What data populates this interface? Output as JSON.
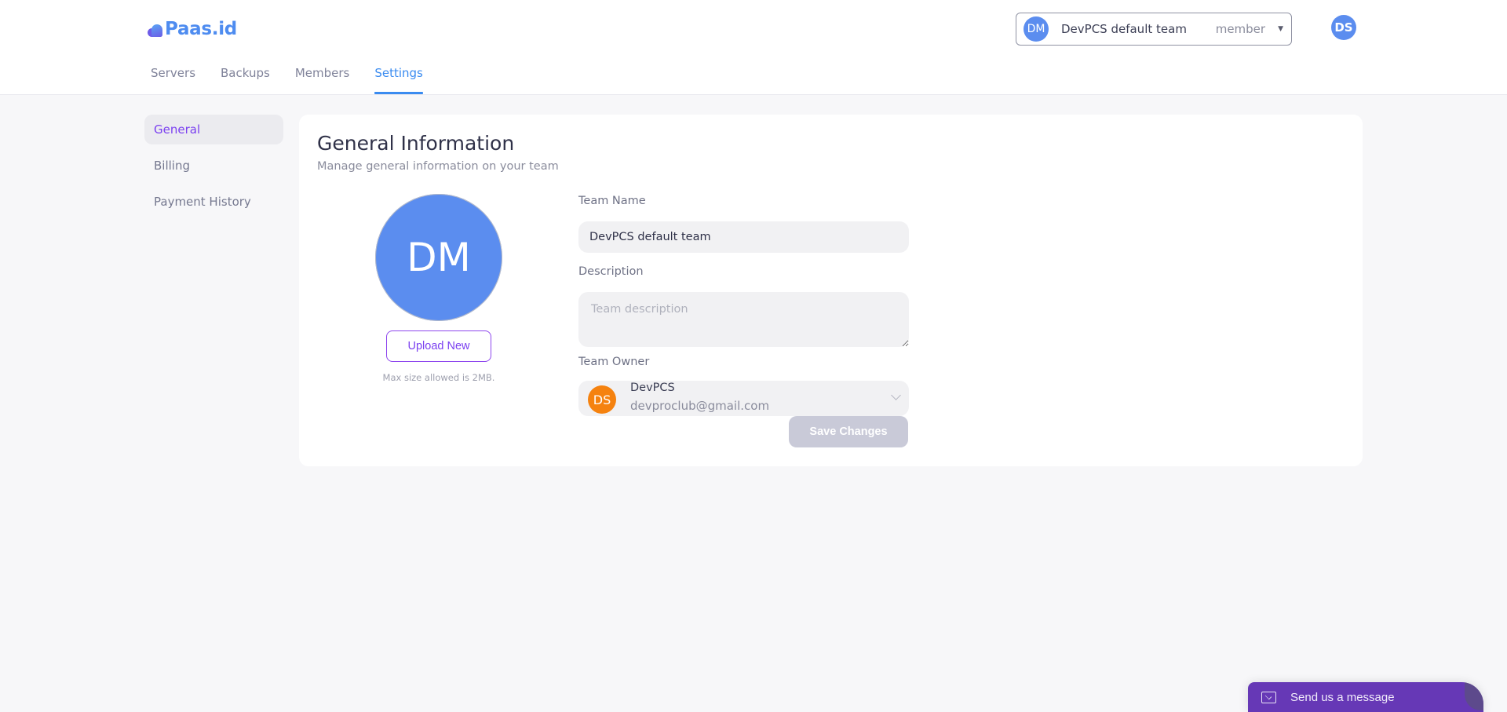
{
  "brand": {
    "name": "Paas.id",
    "color": "#4e8cf0"
  },
  "nav": {
    "tabs": [
      {
        "label": "Servers",
        "active": false
      },
      {
        "label": "Backups",
        "active": false
      },
      {
        "label": "Members",
        "active": false
      },
      {
        "label": "Settings",
        "active": true
      }
    ]
  },
  "team_switcher": {
    "initials": "DM",
    "team_name": "DevPCS default team",
    "role": "member",
    "chevron_icon": "chevron-down-icon"
  },
  "user": {
    "initials": "DS"
  },
  "sidebar": {
    "items": [
      {
        "label": "General",
        "active": true
      },
      {
        "label": "Billing",
        "active": false
      },
      {
        "label": "Payment History",
        "active": false
      }
    ]
  },
  "general": {
    "title": "General Information",
    "subtitle": "Manage general information on your team",
    "avatar_initials": "DM",
    "upload_label": "Upload New",
    "upload_hint": "Max size allowed is 2MB.",
    "form": {
      "team_name_label": "Team Name",
      "team_name_value": "DevPCS default team",
      "description_label": "Description",
      "description_value": "",
      "description_placeholder": "Team description",
      "owner_label": "Team Owner",
      "owner": {
        "initials": "DS",
        "name": "DevPCS",
        "email": "devproclub@gmail.com"
      },
      "save_label": "Save Changes"
    }
  },
  "chat_widget": {
    "label": "Send us a message",
    "icon": "envelope-icon"
  },
  "colors": {
    "accent_purple": "#7a3ff0",
    "accent_blue": "#3a8bf0",
    "avatar_blue": "#5b8def",
    "owner_orange": "#f5820f",
    "chat_purple": "#6638b6",
    "save_disabled": "#c9cad8"
  }
}
